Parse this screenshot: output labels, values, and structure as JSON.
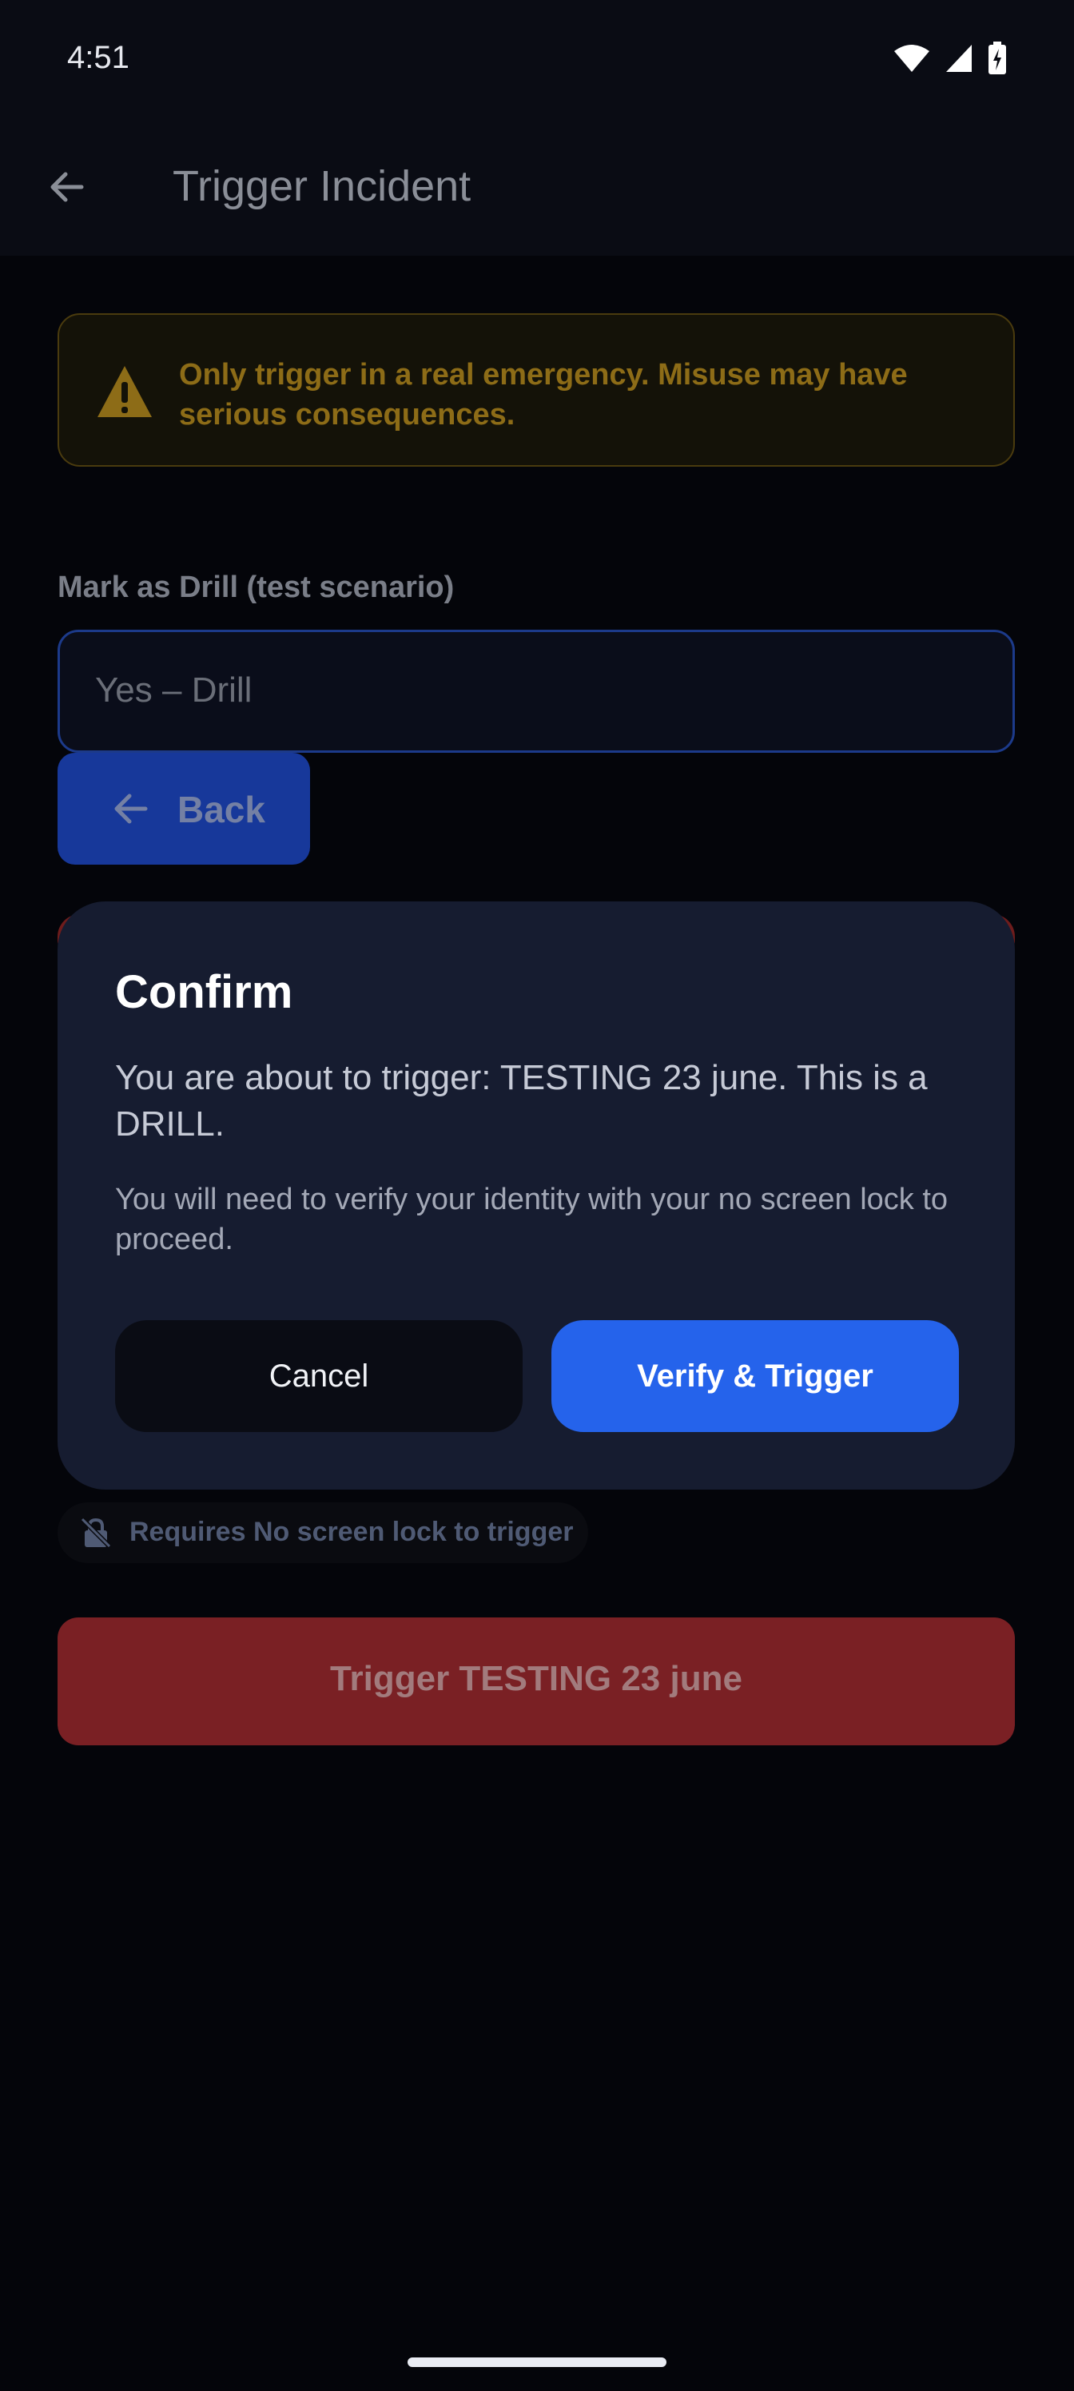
{
  "status_bar": {
    "time": "4:51",
    "icons": [
      "wifi-icon",
      "signal-icon",
      "battery-charging-icon"
    ]
  },
  "app_bar": {
    "title": "Trigger Incident",
    "back_icon": "arrow-left-icon"
  },
  "warning": {
    "icon": "warning-triangle-icon",
    "text": "Only trigger in a real emergency. Misuse may have serious consequences."
  },
  "drill": {
    "label": "Mark as Drill (test scenario)",
    "value": "Yes – Drill"
  },
  "back_button": {
    "label": "Back",
    "icon": "arrow-left-icon"
  },
  "lock_requirement": {
    "icon": "lock-off-icon",
    "text": "Requires No screen lock to trigger"
  },
  "trigger_button": {
    "label": "Trigger TESTING 23 june"
  },
  "dialog": {
    "title": "Confirm",
    "body": "You are about to trigger: TESTING 23 june. This is a DRILL.",
    "note": "You will need to verify your identity with your no screen lock to proceed.",
    "cancel_label": "Cancel",
    "confirm_label": "Verify & Trigger"
  },
  "colors": {
    "background": "#07080c",
    "dialog": "#161c30",
    "accent_blue": "#2563eb",
    "danger_red": "#7a2024",
    "warning_amber": "#8d6c17"
  }
}
